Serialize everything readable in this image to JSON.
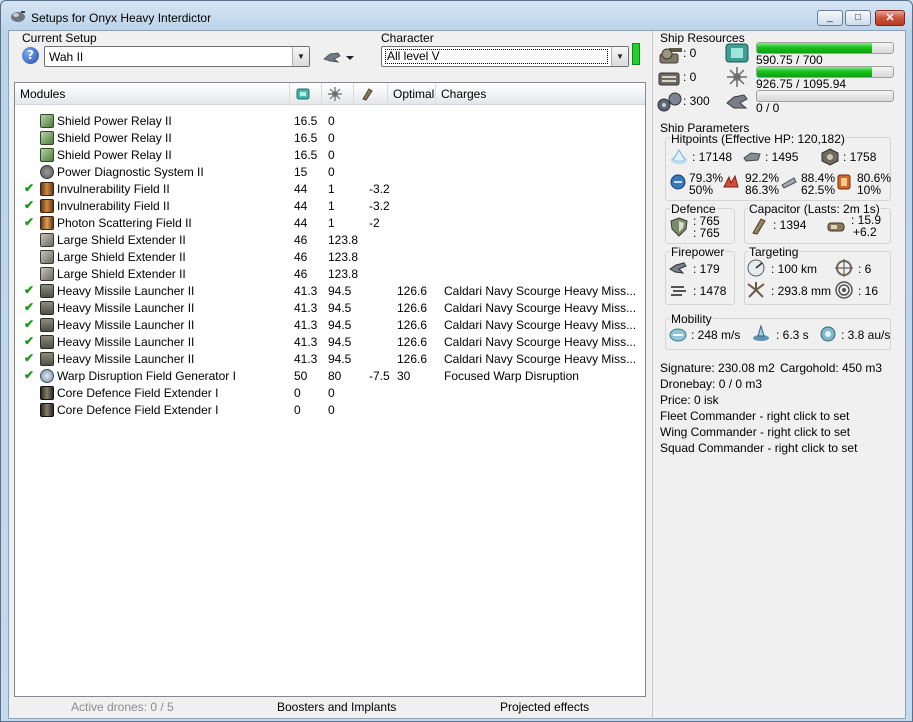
{
  "window": {
    "title": "Setups for Onyx Heavy Interdictor",
    "controls": [
      "_",
      "□",
      "✕"
    ]
  },
  "setup": {
    "label": "Current Setup",
    "value": "Wah II",
    "help": "?"
  },
  "character": {
    "label": "Character",
    "value": "All level V"
  },
  "modules": {
    "headers": [
      "Modules",
      "",
      "",
      "",
      "Optimal",
      "Charges"
    ],
    "rows": [
      {
        "checked": false,
        "icon": "shield-relay-icon",
        "name": "Shield Power Relay II",
        "cpu": "16.5",
        "pg": "0",
        "cap": "",
        "optimal": "",
        "charges": ""
      },
      {
        "checked": false,
        "icon": "shield-relay-icon",
        "name": "Shield Power Relay II",
        "cpu": "16.5",
        "pg": "0",
        "cap": "",
        "optimal": "",
        "charges": ""
      },
      {
        "checked": false,
        "icon": "shield-relay-icon",
        "name": "Shield Power Relay II",
        "cpu": "16.5",
        "pg": "0",
        "cap": "",
        "optimal": "",
        "charges": ""
      },
      {
        "checked": false,
        "icon": "power-diagnostic-icon",
        "name": "Power Diagnostic System II",
        "cpu": "15",
        "pg": "0",
        "cap": "",
        "optimal": "",
        "charges": ""
      },
      {
        "checked": true,
        "icon": "invulnerability-field-icon",
        "name": "Invulnerability Field II",
        "cpu": "44",
        "pg": "1",
        "cap": "-3.2",
        "optimal": "",
        "charges": ""
      },
      {
        "checked": true,
        "icon": "invulnerability-field-icon",
        "name": "Invulnerability Field II",
        "cpu": "44",
        "pg": "1",
        "cap": "-3.2",
        "optimal": "",
        "charges": ""
      },
      {
        "checked": true,
        "icon": "photon-field-icon",
        "name": "Photon Scattering Field II",
        "cpu": "44",
        "pg": "1",
        "cap": "-2",
        "optimal": "",
        "charges": ""
      },
      {
        "checked": false,
        "icon": "shield-extender-icon",
        "name": "Large Shield Extender II",
        "cpu": "46",
        "pg": "123.8",
        "cap": "",
        "optimal": "",
        "charges": ""
      },
      {
        "checked": false,
        "icon": "shield-extender-icon",
        "name": "Large Shield Extender II",
        "cpu": "46",
        "pg": "123.8",
        "cap": "",
        "optimal": "",
        "charges": ""
      },
      {
        "checked": false,
        "icon": "shield-extender-icon",
        "name": "Large Shield Extender II",
        "cpu": "46",
        "pg": "123.8",
        "cap": "",
        "optimal": "",
        "charges": ""
      },
      {
        "checked": true,
        "icon": "missile-launcher-icon",
        "name": "Heavy Missile Launcher II",
        "cpu": "41.3",
        "pg": "94.5",
        "cap": "",
        "optimal": "126.6",
        "charges": "Caldari Navy Scourge Heavy Miss..."
      },
      {
        "checked": true,
        "icon": "missile-launcher-icon",
        "name": "Heavy Missile Launcher II",
        "cpu": "41.3",
        "pg": "94.5",
        "cap": "",
        "optimal": "126.6",
        "charges": "Caldari Navy Scourge Heavy Miss..."
      },
      {
        "checked": true,
        "icon": "missile-launcher-icon",
        "name": "Heavy Missile Launcher II",
        "cpu": "41.3",
        "pg": "94.5",
        "cap": "",
        "optimal": "126.6",
        "charges": "Caldari Navy Scourge Heavy Miss..."
      },
      {
        "checked": true,
        "icon": "missile-launcher-icon",
        "name": "Heavy Missile Launcher II",
        "cpu": "41.3",
        "pg": "94.5",
        "cap": "",
        "optimal": "126.6",
        "charges": "Caldari Navy Scourge Heavy Miss..."
      },
      {
        "checked": true,
        "icon": "missile-launcher-icon",
        "name": "Heavy Missile Launcher II",
        "cpu": "41.3",
        "pg": "94.5",
        "cap": "",
        "optimal": "126.6",
        "charges": "Caldari Navy Scourge Heavy Miss..."
      },
      {
        "checked": true,
        "icon": "warp-disruption-icon",
        "name": "Warp Disruption Field Generator I",
        "cpu": "50",
        "pg": "80",
        "cap": "-7.5",
        "optimal": "30",
        "charges": "Focused Warp Disruption"
      },
      {
        "checked": false,
        "icon": "rig-icon",
        "name": "Core Defence Field Extender I",
        "cpu": "0",
        "pg": "0",
        "cap": "",
        "optimal": "",
        "charges": ""
      },
      {
        "checked": false,
        "icon": "rig-icon",
        "name": "Core Defence Field Extender I",
        "cpu": "0",
        "pg": "0",
        "cap": "",
        "optimal": "",
        "charges": ""
      }
    ]
  },
  "bottom_tabs": {
    "drones": "Active drones: 0 / 5",
    "boosters": "Boosters and Implants",
    "projected": "Projected effects"
  },
  "ship_resources": {
    "title": "Ship Resources",
    "turret_slots": ": 0",
    "launcher_slots": ": 0",
    "calibration": ": 300",
    "cpu": {
      "text": "590.75 / 700",
      "fraction": 0.844
    },
    "powergrid": {
      "text": "926.75 / 1095.94",
      "fraction": 0.846
    },
    "drone_bandwidth": {
      "text": "0 / 0",
      "fraction": 0
    }
  },
  "ship_parameters": {
    "title": "Ship Parameters",
    "hitpoints": {
      "label": "Hitpoints (Effective HP: 120,182)",
      "shield": ": 17148",
      "armor": ": 1495",
      "hull": ": 1758",
      "em": [
        "79.3%",
        "50%"
      ],
      "thermal": [
        "92.2%",
        "86.3%"
      ],
      "kinetic": [
        "88.4%",
        "62.5%"
      ],
      "explosive": [
        "80.6%",
        "10%"
      ]
    },
    "defence": {
      "label": "Defence",
      "values": [
        ": 765",
        ": 765"
      ]
    },
    "capacitor": {
      "label": "Capacitor (Lasts: 2m 1s)",
      "amount": ": 1394",
      "recharge": [
        ": 15.9",
        "+6.2"
      ]
    },
    "firepower": {
      "label": "Firepower",
      "dps": ": 179",
      "volley": ": 1478"
    },
    "targeting": {
      "label": "Targeting",
      "range": ": 100 km",
      "targets": ": 6",
      "scan_res": ": 293.8 mm",
      "sensor": ": 16"
    },
    "mobility": {
      "label": "Mobility",
      "speed": ": 248 m/s",
      "align": ": 6.3 s",
      "warp": ": 3.8 au/s"
    }
  },
  "info": {
    "signature": "Signature: 230.08 m2",
    "cargohold": "Cargohold: 450 m3",
    "dronebay": "Dronebay: 0 / 0 m3",
    "price": "Price: 0 isk",
    "fleet": "Fleet Commander - right click to set",
    "wing": "Wing Commander - right click to set",
    "squad": "Squad Commander - right click to set"
  },
  "colors": {
    "bar_fill": "#17c21c",
    "status_ok": "#22d12e",
    "check": "#1a9a1a"
  }
}
